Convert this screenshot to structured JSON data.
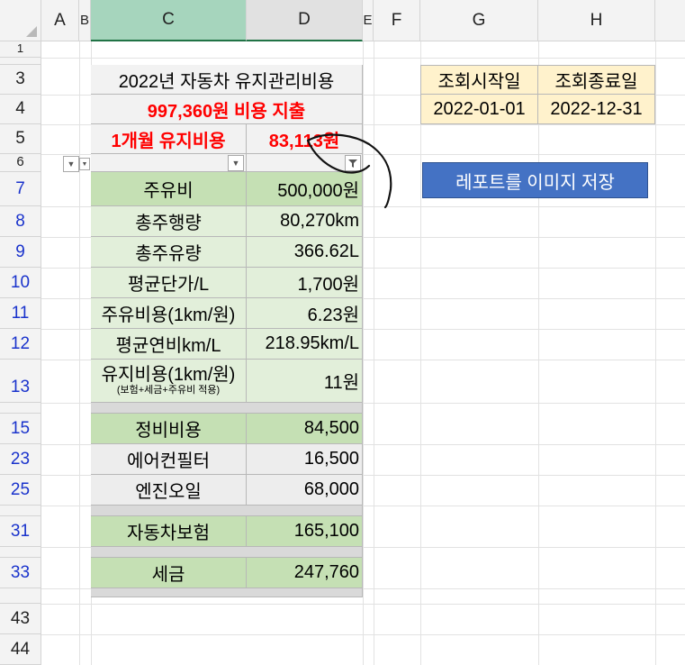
{
  "columns": [
    "A",
    "B",
    "C",
    "D",
    "E",
    "F",
    "G",
    "H"
  ],
  "rows": [
    "1",
    "3",
    "4",
    "5",
    "6",
    "7",
    "8",
    "9",
    "10",
    "11",
    "12",
    "13",
    "15",
    "23",
    "25",
    "31",
    "33",
    "43",
    "44"
  ],
  "table": {
    "title": "2022년 자동차 유지관리비용",
    "total": "997,360원 비용 지출",
    "monthly_label": "1개월 유지비용",
    "monthly_value": "83,113원",
    "items": [
      {
        "label": "주유비",
        "value": "500,000원"
      },
      {
        "label": "총주행량",
        "value": "80,270km"
      },
      {
        "label": "총주유량",
        "value": "366.62L"
      },
      {
        "label": "평균단가/L",
        "value": "1,700원"
      },
      {
        "label": "주유비용(1km/원)",
        "value": "6.23원"
      },
      {
        "label": "평균연비km/L",
        "value": "218.95km/L"
      }
    ],
    "maint_cost_label": "유지비용(1km/원)",
    "maint_cost_note": "(보험+세금+주유비 적용)",
    "maint_cost_value": "11원",
    "repair_label": "정비비용",
    "repair_value": "84,500",
    "aircon_label": "에어컨필터",
    "aircon_value": "16,500",
    "oil_label": "엔진오일",
    "oil_value": "68,000",
    "insurance_label": "자동차보험",
    "insurance_value": "165,100",
    "tax_label": "세금",
    "tax_value": "247,760"
  },
  "query": {
    "start_label": "조회시작일",
    "end_label": "조회종료일",
    "start_value": "2022-01-01",
    "end_value": "2022-12-31"
  },
  "report_button": "레포트를 이미지 저장",
  "icons": {
    "filter": "filter-icon",
    "dropdown": "dropdown-arrow-icon"
  },
  "colors": {
    "header_green": "#c5e0b4",
    "light_green": "#e2efda",
    "button_blue": "#4472c4",
    "accent_red": "#ff0000",
    "query_yellow": "#fff2cc"
  }
}
